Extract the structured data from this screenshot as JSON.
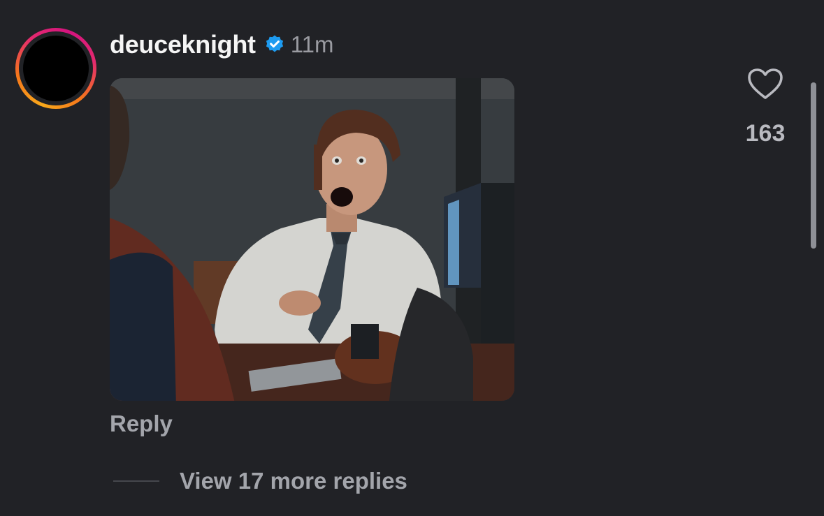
{
  "comment": {
    "username": "deuceknight",
    "verified": true,
    "timestamp": "11m",
    "media": {
      "type": "gif"
    },
    "likes": {
      "count": "163",
      "icon": "heart-outline-icon"
    },
    "reply_label": "Reply",
    "view_more_label": "View 17 more replies"
  },
  "colors": {
    "background": "#212226",
    "verified_badge": "#1d9bf0",
    "avatar_ring_start": "#f9a91b",
    "avatar_ring_end": "#d4137f",
    "secondary_text": "#a3a5ab"
  }
}
